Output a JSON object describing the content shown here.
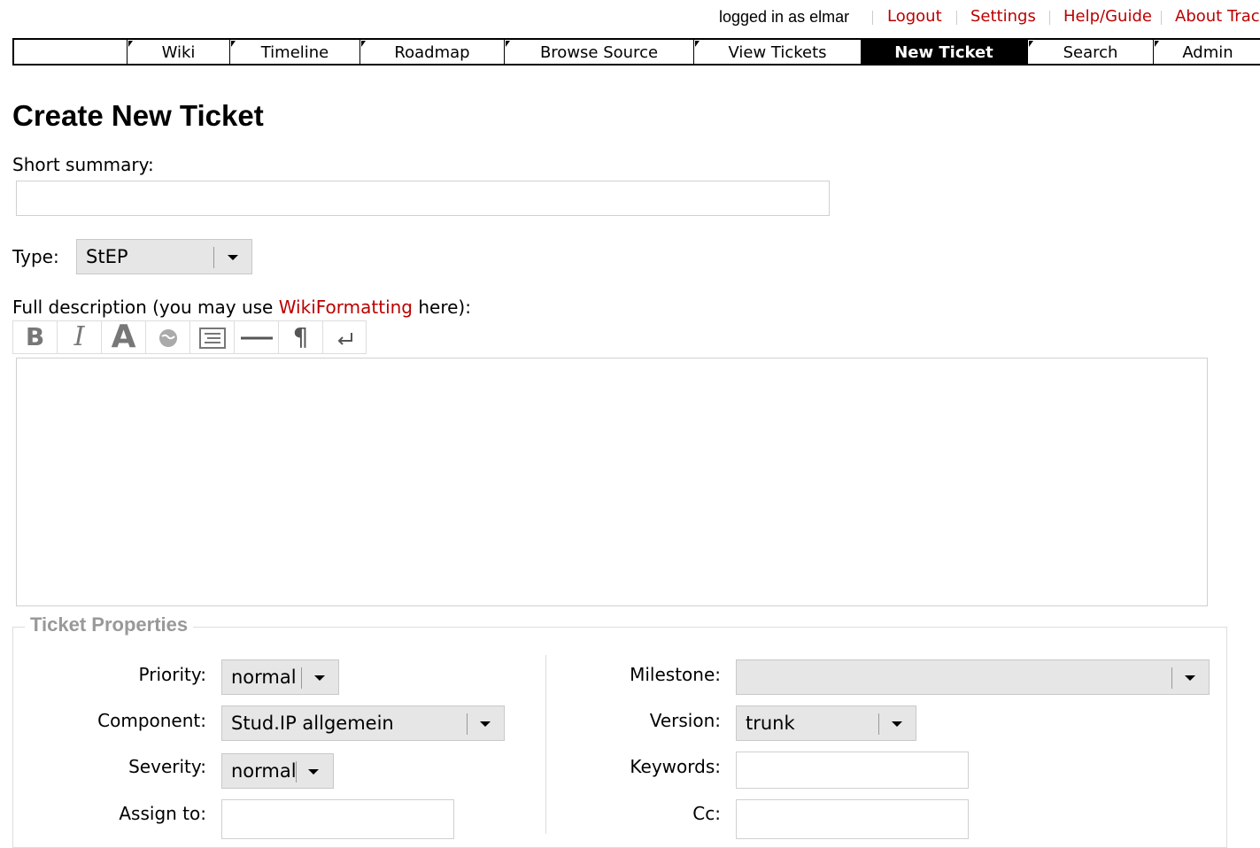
{
  "metanav": {
    "logged_in": "logged in as elmar",
    "logout": "Logout",
    "settings": "Settings",
    "help": "Help/Guide",
    "about": "About Trac"
  },
  "mainnav": {
    "tabs": [
      {
        "label": "Wiki"
      },
      {
        "label": "Timeline"
      },
      {
        "label": "Roadmap"
      },
      {
        "label": "Browse Source"
      },
      {
        "label": "View Tickets"
      },
      {
        "label": "New Ticket",
        "active": true
      },
      {
        "label": "Search"
      },
      {
        "label": "Admin"
      }
    ]
  },
  "page": {
    "title": "Create New Ticket",
    "summary_label": "Short summary:",
    "summary_value": "",
    "type_label": "Type:",
    "type_value": "StEP",
    "description_label_pre": "Full description (you may use ",
    "description_link": "WikiFormatting",
    "description_label_post": " here):",
    "description_value": ""
  },
  "toolbar": {
    "bold": "B",
    "italic": "I",
    "heading": "A",
    "link": "link",
    "code": "code-block",
    "hr": "horizontal-rule",
    "paragraph": "¶",
    "linebreak": "line-break"
  },
  "properties": {
    "legend": "Ticket Properties",
    "priority_label": "Priority:",
    "priority_value": "normal",
    "component_label": "Component:",
    "component_value": "Stud.IP allgemein",
    "severity_label": "Severity:",
    "severity_value": "normal",
    "assign_label": "Assign to:",
    "assign_value": "",
    "milestone_label": "Milestone:",
    "milestone_value": "",
    "version_label": "Version:",
    "version_value": "trunk",
    "keywords_label": "Keywords:",
    "keywords_value": "",
    "cc_label": "Cc:",
    "cc_value": ""
  }
}
